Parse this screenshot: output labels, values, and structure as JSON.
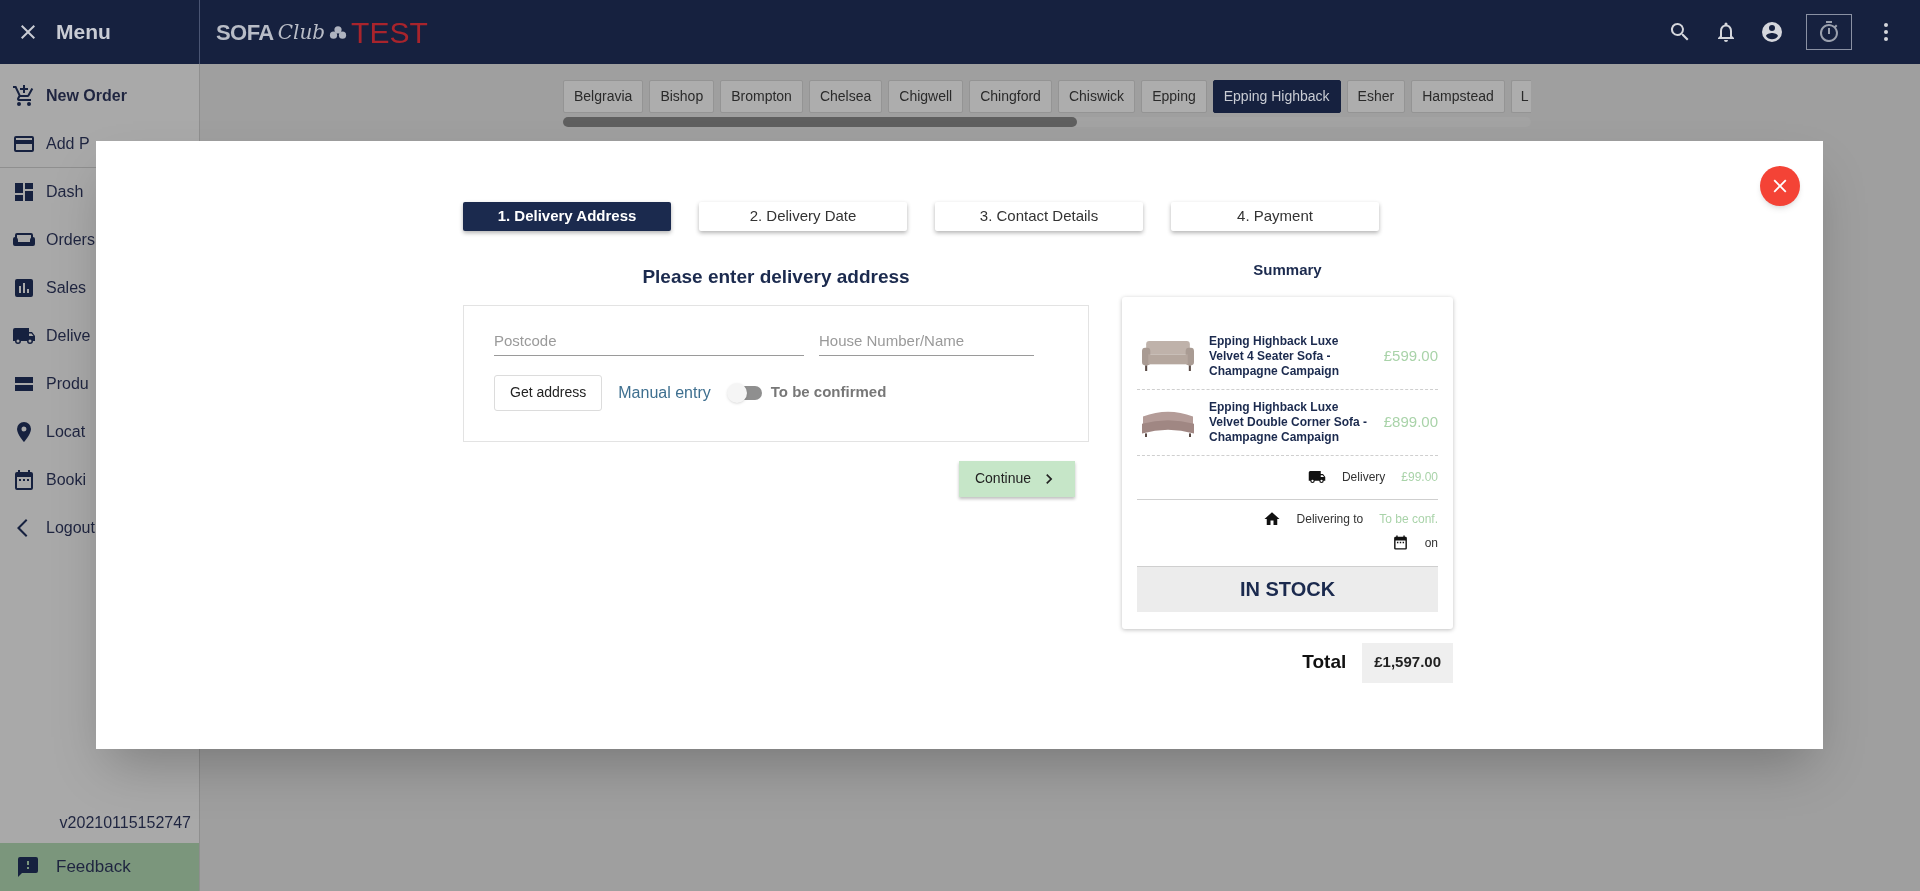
{
  "header": {
    "menu_label": "Menu",
    "logo": {
      "brand": "SOFA",
      "script": "Club",
      "env": "TEST"
    }
  },
  "sidebar": {
    "items": [
      {
        "label": "New Order",
        "bold": true
      },
      {
        "label": "Add P",
        "bold": false
      },
      {
        "label": "Dash",
        "bold": false
      },
      {
        "label": "Orders",
        "bold": false
      },
      {
        "label": "Sales",
        "bold": false
      },
      {
        "label": "Delive",
        "bold": false
      },
      {
        "label": "Produ",
        "bold": false
      },
      {
        "label": "Locat",
        "bold": false
      },
      {
        "label": "Booki",
        "bold": false
      },
      {
        "label": "Logout",
        "bold": false
      }
    ],
    "version": "v20210115152747",
    "feedback": "Feedback"
  },
  "location_tabs": [
    {
      "label": "Belgravia",
      "selected": false
    },
    {
      "label": "Bishop",
      "selected": false
    },
    {
      "label": "Brompton",
      "selected": false
    },
    {
      "label": "Chelsea",
      "selected": false
    },
    {
      "label": "Chigwell",
      "selected": false
    },
    {
      "label": "Chingford",
      "selected": false
    },
    {
      "label": "Chiswick",
      "selected": false
    },
    {
      "label": "Epping",
      "selected": false
    },
    {
      "label": "Epping Highback",
      "selected": true
    },
    {
      "label": "Esher",
      "selected": false
    },
    {
      "label": "Hampstead",
      "selected": false
    },
    {
      "label": "L",
      "selected": false
    }
  ],
  "dialog": {
    "steps": [
      {
        "label": "1. Delivery Address",
        "selected": true
      },
      {
        "label": "2. Delivery Date",
        "selected": false
      },
      {
        "label": "3. Contact Details",
        "selected": false
      },
      {
        "label": "4. Payment",
        "selected": false
      }
    ],
    "heading": "Please enter delivery address",
    "postcode": {
      "placeholder": "Postcode"
    },
    "house": {
      "placeholder": "House Number/Name"
    },
    "get_address": "Get address",
    "manual_entry": "Manual entry",
    "toggle": {
      "label": "To be confirmed",
      "on": false
    },
    "continue": "Continue",
    "summary": {
      "title": "Summary",
      "items": [
        {
          "kind": "picture",
          "name": "Epping Highback Luxe Velvet 4 Seater Sofa - Champagne Campaign",
          "price": "£599.00"
        },
        {
          "kind": "picture",
          "name": "Epping Highback Luxe Velvet Double Corner Sofa - Champagne Campaign",
          "price": "£899.00"
        }
      ],
      "delivery_label": "Delivery",
      "delivery_price": "£99.00",
      "delivering_to": "Delivering to",
      "address_value": "To be conf.",
      "on_label": "on",
      "stock": "IN STOCK",
      "total_label": "Total",
      "total": "£1,597.00"
    }
  }
}
